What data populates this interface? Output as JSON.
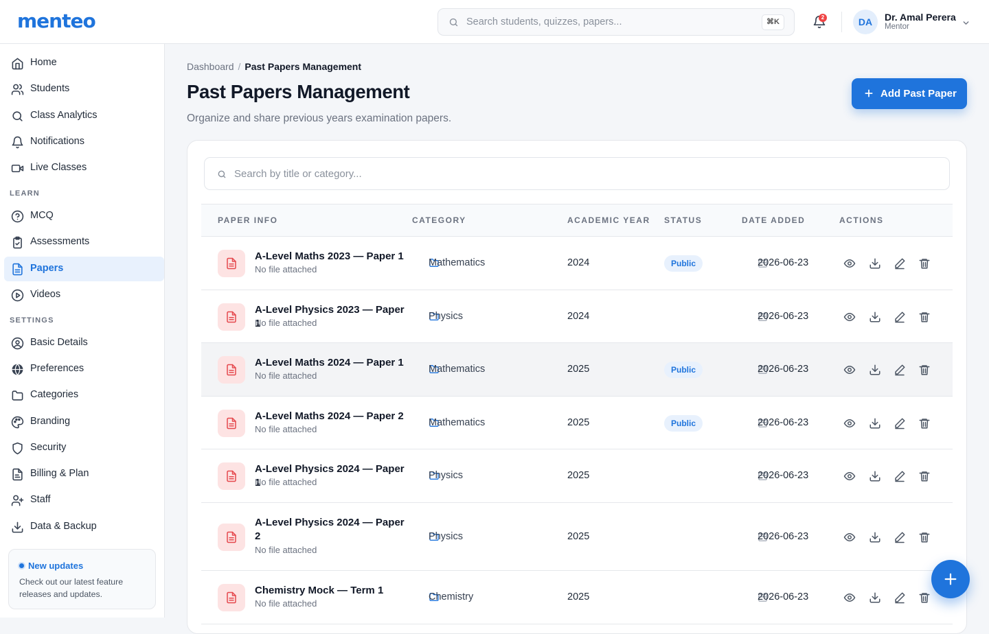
{
  "app": {
    "logo": "menteo"
  },
  "topbar": {
    "search_placeholder": "Search students, quizzes, papers...",
    "shortcut": "⌘K",
    "notification_count": "2",
    "user": {
      "initials": "DA",
      "name": "Dr. Amal Perera",
      "role": "Mentor"
    }
  },
  "sidebar": {
    "main": [
      {
        "label": "Home",
        "icon": "home-icon"
      },
      {
        "label": "Students",
        "icon": "users-icon"
      },
      {
        "label": "Class Analytics",
        "icon": "search-icon"
      },
      {
        "label": "Notifications",
        "icon": "bell-icon"
      },
      {
        "label": "Live Classes",
        "icon": "video-icon"
      }
    ],
    "learn_heading": "LEARN",
    "learn": [
      {
        "label": "MCQ",
        "icon": "help-circle-icon"
      },
      {
        "label": "Assessments",
        "icon": "clipboard-check-icon"
      },
      {
        "label": "Papers",
        "icon": "file-icon",
        "active": true
      },
      {
        "label": "Videos",
        "icon": "play-circle-icon"
      }
    ],
    "settings_heading": "SETTINGS",
    "settings": [
      {
        "label": "Basic Details",
        "icon": "user-circle-icon"
      },
      {
        "label": "Preferences",
        "icon": "globe-icon"
      },
      {
        "label": "Categories",
        "icon": "folder-icon"
      },
      {
        "label": "Branding",
        "icon": "palette-icon"
      },
      {
        "label": "Security",
        "icon": "shield-icon"
      },
      {
        "label": "Billing & Plan",
        "icon": "receipt-icon"
      },
      {
        "label": "Staff",
        "icon": "user-plus-icon"
      },
      {
        "label": "Data & Backup",
        "icon": "download-icon"
      }
    ],
    "updates": {
      "title": "New updates",
      "text": "Check out our latest feature releases and updates."
    }
  },
  "page": {
    "breadcrumb": {
      "parent": "Dashboard",
      "separator": "/",
      "current": "Past Papers Management"
    },
    "title": "Past Papers Management",
    "subtitle": "Organize and share previous years examination papers.",
    "add_button": "Add Past Paper"
  },
  "table": {
    "search_placeholder": "Search by title or category...",
    "headers": {
      "paper": "PAPER INFO",
      "category": "CATEGORY",
      "year": "ACADEMIC YEAR",
      "status": "STATUS",
      "date": "DATE ADDED",
      "actions": "ACTIONS"
    },
    "rows": [
      {
        "title": "A-Level Maths 2023 — Paper 1",
        "file": "No file attached",
        "category": "Mathematics",
        "year": "2024",
        "status": "Public",
        "date": "2026-06-23"
      },
      {
        "title": "A-Level Physics 2023 — Paper 1",
        "file": "No file attached",
        "category": "Physics",
        "year": "2024",
        "status": "",
        "date": "2026-06-23"
      },
      {
        "title": "A-Level Maths 2024 — Paper 1",
        "file": "No file attached",
        "category": "Mathematics",
        "year": "2025",
        "status": "Public",
        "date": "2026-06-23",
        "highlighted": true
      },
      {
        "title": "A-Level Maths 2024 — Paper 2",
        "file": "No file attached",
        "category": "Mathematics",
        "year": "2025",
        "status": "Public",
        "date": "2026-06-23"
      },
      {
        "title": "A-Level Physics 2024 — Paper 1",
        "file": "No file attached",
        "category": "Physics",
        "year": "2025",
        "status": "",
        "date": "2026-06-23"
      },
      {
        "title": "A-Level Physics 2024 — Paper 2",
        "file": "No file attached",
        "category": "Physics",
        "year": "2025",
        "status": "",
        "date": "2026-06-23"
      },
      {
        "title": "Chemistry Mock — Term 1",
        "file": "No file attached",
        "category": "Chemistry",
        "year": "2025",
        "status": "",
        "date": "2026-06-23"
      }
    ]
  },
  "colors": {
    "primary": "#1f74dc",
    "danger": "#ef4444",
    "file_icon_bg": "#fde3e3"
  }
}
